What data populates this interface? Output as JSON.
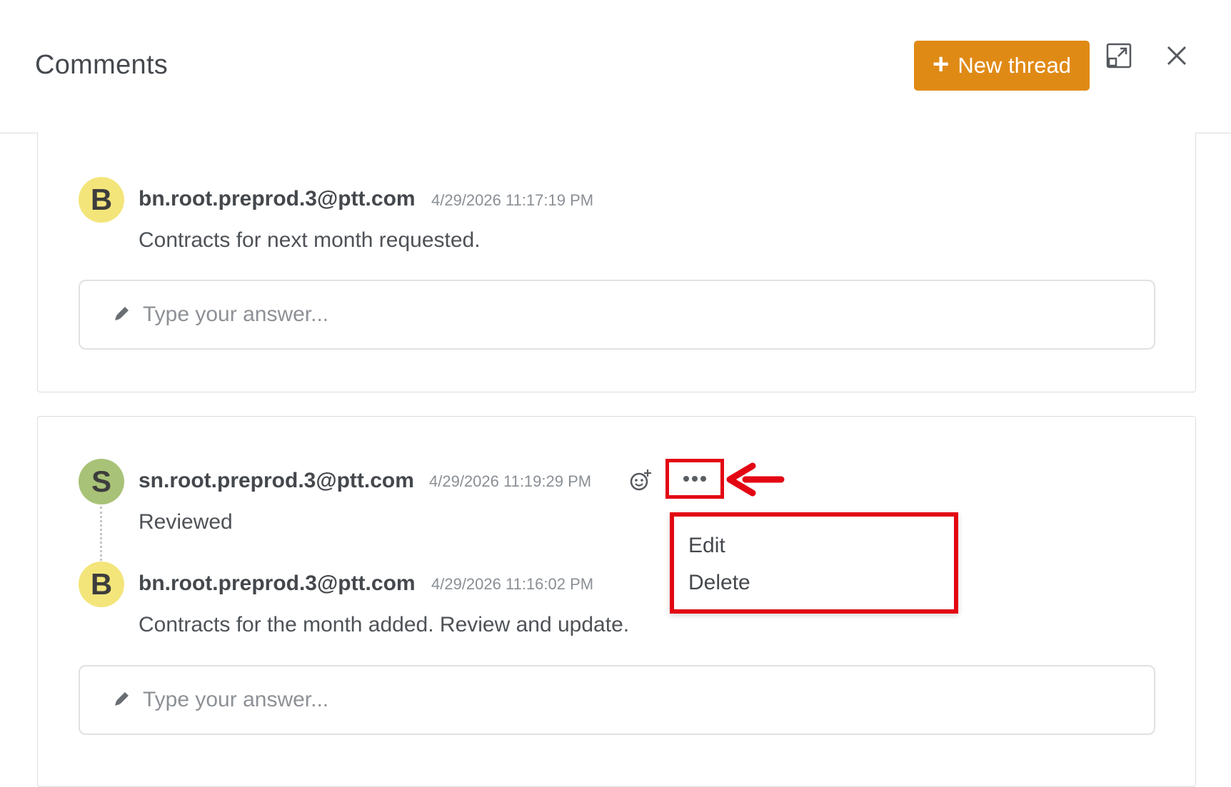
{
  "header": {
    "title": "Comments",
    "new_thread_label": "New thread",
    "accent_color": "#e08a16"
  },
  "threads": [
    {
      "comments": [
        {
          "avatar_letter": "B",
          "author": "bn.root.preprod.3@ptt.com",
          "timestamp": "4/29/2026 11:17:19 PM",
          "text": "Contracts for next month requested."
        }
      ],
      "reply_placeholder": "Type your answer..."
    },
    {
      "comments": [
        {
          "avatar_letter": "S",
          "author": "sn.root.preprod.3@ptt.com",
          "timestamp": "4/29/2026 11:19:29 PM",
          "text": "Reviewed"
        },
        {
          "avatar_letter": "B",
          "author": "bn.root.preprod.3@ptt.com",
          "timestamp": "4/29/2026 11:16:02 PM",
          "text": "Contracts for the month added. Review and update."
        }
      ],
      "reply_placeholder": "Type your answer..."
    }
  ],
  "context_menu": {
    "items": [
      "Edit",
      "Delete"
    ]
  },
  "highlight_color": "#e30613",
  "icons": {
    "new_thread": "plus-icon",
    "expand": "expand-icon",
    "close": "close-icon",
    "reply": "pencil-icon",
    "reaction": "add-reaction-icon",
    "more": "more-options-icon",
    "annotation": "arrow-left-icon"
  }
}
